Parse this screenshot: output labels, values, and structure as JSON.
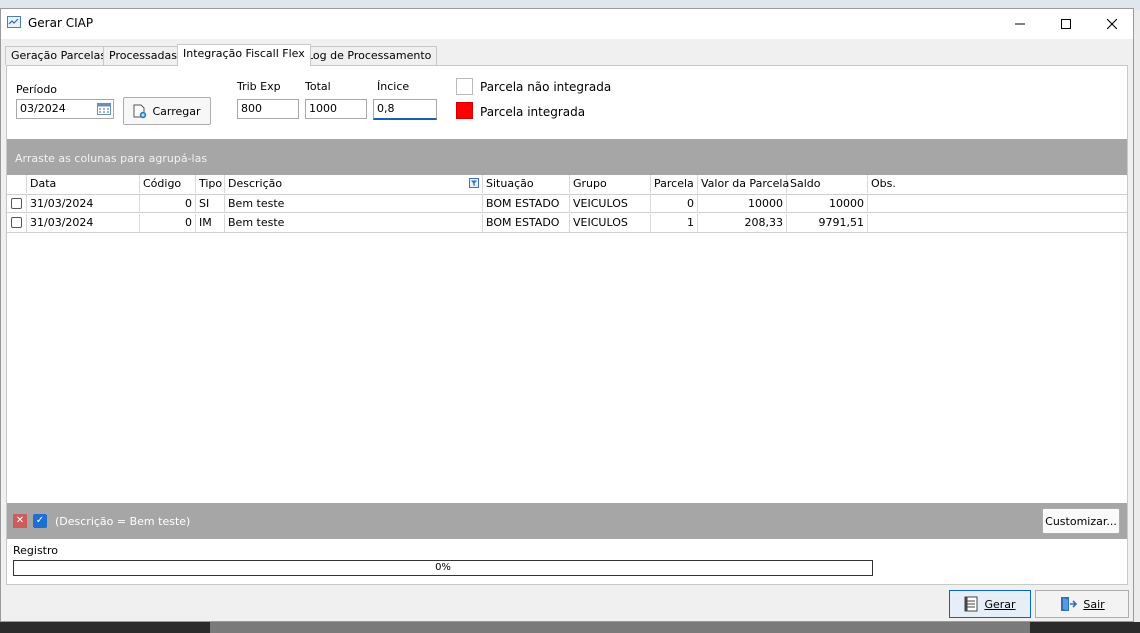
{
  "window": {
    "title": "Gerar CIAP"
  },
  "tabs": [
    {
      "label": "Geração Parcelas"
    },
    {
      "label": "Processadas"
    },
    {
      "label": "Integração Fiscall Flex",
      "active": true
    },
    {
      "label": "Log de Processamento"
    }
  ],
  "form": {
    "periodo_label": "Período",
    "periodo_value": "03/2024",
    "carregar_label": "Carregar",
    "trib_exp_label": "Trib Exp",
    "trib_exp_value": "800",
    "total_label": "Total",
    "total_value": "1000",
    "indice_label": "Íncice",
    "indice_value": "0,8"
  },
  "legend": {
    "nao_integrada": "Parcela  não integrada",
    "integrada": "Parcela  integrada",
    "nao_integrada_color": "#ffffff",
    "integrada_color": "#ff0000"
  },
  "grid": {
    "group_hint": "Arraste as colunas para agrupá-las",
    "columns": [
      "Data",
      "Código",
      "Tipo",
      "Descrição",
      "Situação",
      "Grupo",
      "Parcela",
      "Valor da Parcela",
      "Saldo",
      "Obs."
    ],
    "rows": [
      {
        "data": "31/03/2024",
        "codigo": "0",
        "tipo": "SI",
        "descricao": "Bem teste",
        "situacao": "BOM ESTADO",
        "grupo": "VEICULOS",
        "parcela": "0",
        "valor": "10000",
        "saldo": "10000",
        "obs": ""
      },
      {
        "data": "31/03/2024",
        "codigo": "0",
        "tipo": "IM",
        "descricao": "Bem teste",
        "situacao": "BOM ESTADO",
        "grupo": "VEICULOS",
        "parcela": "1",
        "valor": "208,33",
        "saldo": "9791,51",
        "obs": ""
      }
    ]
  },
  "filter": {
    "text": "(Descrição = Bem teste)",
    "customize_label": "Customizar..."
  },
  "registro": {
    "label": "Registro",
    "progress": "0%"
  },
  "footer": {
    "gerar_label": "Gerar",
    "sair_label": "Sair"
  }
}
